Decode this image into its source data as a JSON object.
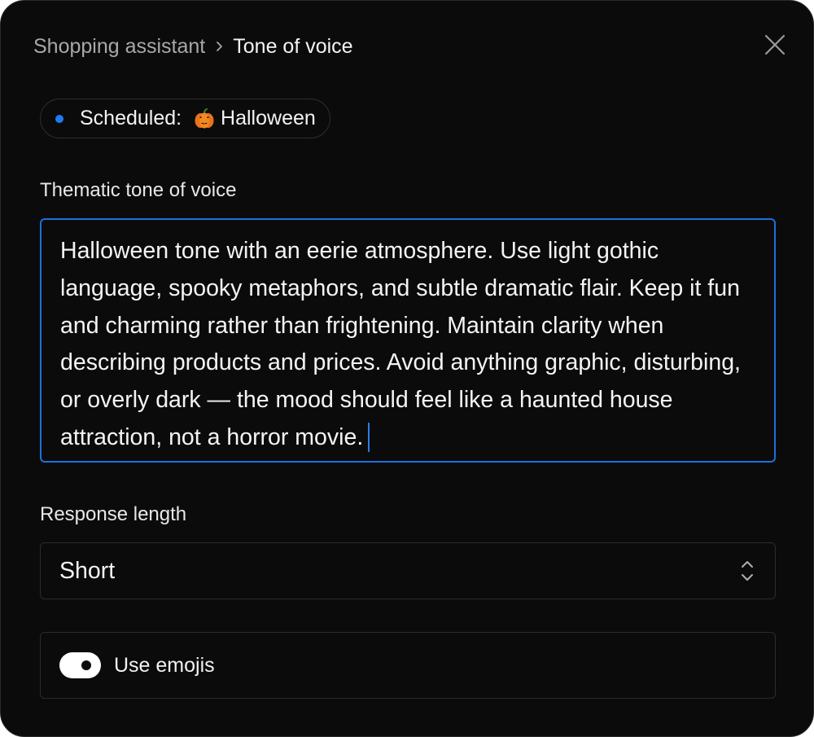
{
  "breadcrumb": {
    "parent": "Shopping assistant",
    "separator_icon": "chevron-right-icon",
    "current": "Tone of voice"
  },
  "close_icon": "close-icon",
  "status": {
    "label": "Scheduled: ",
    "icon": "pumpkin-icon",
    "event": "Halloween",
    "dot_color": "#1f7cf0"
  },
  "tone": {
    "label": "Thematic tone of voice",
    "value": "Halloween tone with an eerie atmosphere. Use light gothic language, spooky metaphors, and subtle dramatic flair. Keep it fun and charming rather than frightening. Maintain clarity when describing products and prices. Avoid anything graphic, disturbing, or overly dark — the mood should feel like a haunted house attraction, not a horror movie."
  },
  "response_length": {
    "label": "Response length",
    "value": "Short",
    "icon": "chevron-up-down-icon"
  },
  "emojis": {
    "label": "Use emojis",
    "enabled": true
  },
  "colors": {
    "background": "#0b0b0b",
    "accent": "#1d70dd",
    "border": "#2c2c2c",
    "text": "#f4f4f4",
    "muted_text": "#a8a8a8"
  }
}
